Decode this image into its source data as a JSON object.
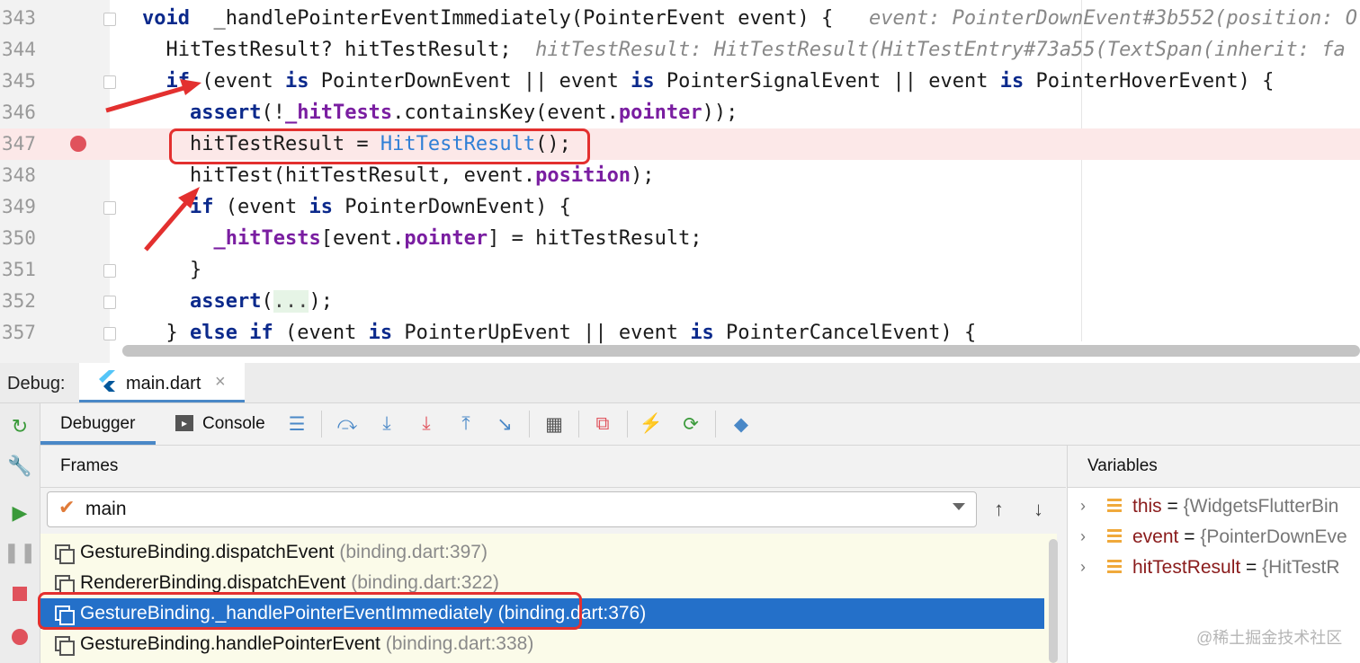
{
  "editor": {
    "lines": [
      {
        "num": "343",
        "fold": true,
        "breakpoint": false,
        "tokens": [
          [
            "kw",
            "void"
          ],
          [
            "",
            "  _handlePointerEventImmediately(PointerEvent event) {   "
          ],
          [
            "hint",
            "event: PointerDownEvent#3b552(position: Of"
          ]
        ]
      },
      {
        "num": "344",
        "fold": false,
        "breakpoint": false,
        "tokens": [
          [
            "",
            "  HitTestResult? hitTestResult;  "
          ],
          [
            "hint",
            "hitTestResult: HitTestResult(HitTestEntry#73a55(TextSpan(inherit: fa"
          ]
        ]
      },
      {
        "num": "345",
        "fold": true,
        "breakpoint": false,
        "tokens": [
          [
            "",
            "  "
          ],
          [
            "kw",
            "if"
          ],
          [
            "",
            " (event "
          ],
          [
            "kw",
            "is"
          ],
          [
            "",
            " PointerDownEvent || event "
          ],
          [
            "kw",
            "is"
          ],
          [
            "",
            " PointerSignalEvent || event "
          ],
          [
            "kw",
            "is"
          ],
          [
            "",
            " PointerHoverEvent) {"
          ]
        ]
      },
      {
        "num": "346",
        "fold": false,
        "breakpoint": false,
        "tokens": [
          [
            "",
            "    "
          ],
          [
            "kw",
            "assert"
          ],
          [
            "",
            "(!"
          ],
          [
            "fld",
            "_hitTests"
          ],
          [
            "",
            ".containsKey(event."
          ],
          [
            "fld",
            "pointer"
          ],
          [
            "",
            "));"
          ]
        ]
      },
      {
        "num": "347",
        "fold": false,
        "breakpoint": true,
        "tokens": [
          [
            "",
            "    hitTestResult = "
          ],
          [
            "typ",
            "HitTestResult"
          ],
          [
            "",
            "();"
          ]
        ]
      },
      {
        "num": "348",
        "fold": false,
        "breakpoint": false,
        "tokens": [
          [
            "",
            "    hitTest(hitTestResult, event."
          ],
          [
            "fld",
            "position"
          ],
          [
            "",
            ");"
          ]
        ]
      },
      {
        "num": "349",
        "fold": true,
        "breakpoint": false,
        "tokens": [
          [
            "",
            "    "
          ],
          [
            "kw",
            "if"
          ],
          [
            "",
            " (event "
          ],
          [
            "kw",
            "is"
          ],
          [
            "",
            " PointerDownEvent) {"
          ]
        ]
      },
      {
        "num": "350",
        "fold": false,
        "breakpoint": false,
        "tokens": [
          [
            "",
            "      "
          ],
          [
            "fld",
            "_hitTests"
          ],
          [
            "",
            "[event."
          ],
          [
            "fld",
            "pointer"
          ],
          [
            "",
            "] = hitTestResult;"
          ]
        ]
      },
      {
        "num": "351",
        "fold": true,
        "breakpoint": false,
        "tokens": [
          [
            "",
            "    }"
          ]
        ]
      },
      {
        "num": "352",
        "fold": true,
        "breakpoint": false,
        "tokens": [
          [
            "",
            "    "
          ],
          [
            "kw",
            "assert"
          ],
          [
            "",
            "("
          ],
          [
            "fold-box",
            "..."
          ],
          [
            "",
            ");"
          ]
        ]
      },
      {
        "num": "357",
        "fold": true,
        "breakpoint": false,
        "tokens": [
          [
            "",
            "  } "
          ],
          [
            "kw",
            "else if"
          ],
          [
            "",
            " (event "
          ],
          [
            "kw",
            "is"
          ],
          [
            "",
            " PointerUpEvent || event "
          ],
          [
            "kw",
            "is"
          ],
          [
            "",
            " PointerCancelEvent) {"
          ]
        ]
      }
    ]
  },
  "debug": {
    "label": "Debug:",
    "tab": "main.dart",
    "tab_close": "×",
    "tabs": [
      "Debugger",
      "Console"
    ],
    "frames_title": "Frames",
    "variables_title": "Variables",
    "thread": "main",
    "frames": [
      {
        "name": "GestureBinding.dispatchEvent",
        "loc": "(binding.dart:397)",
        "selected": false
      },
      {
        "name": "RendererBinding.dispatchEvent",
        "loc": "(binding.dart:322)",
        "selected": false
      },
      {
        "name": "GestureBinding._handlePointerEventImmediately",
        "loc": "(binding.dart:376)",
        "selected": true
      },
      {
        "name": "GestureBinding.handlePointerEvent",
        "loc": "(binding.dart:338)",
        "selected": false
      }
    ],
    "variables": [
      {
        "name": "this",
        "value": "{WidgetsFlutterBin"
      },
      {
        "name": "event",
        "value": "{PointerDownEve"
      },
      {
        "name": "hitTestResult",
        "value": "{HitTestR"
      }
    ],
    "watermark": "@稀土掘金技术社区"
  },
  "icons": {
    "rail": [
      "rerun-icon",
      "settings-wrench-icon",
      "resume-icon",
      "pause-icon",
      "stop-icon",
      "view-breakpoints-icon"
    ],
    "toolbar": [
      "list-icon",
      "step-over-icon",
      "step-into-icon",
      "force-step-into-icon",
      "step-out-icon",
      "run-to-cursor-icon",
      "evaluate-icon",
      "drop-frame-icon",
      "hot-reload-icon",
      "hot-restart-icon",
      "devtools-icon"
    ]
  },
  "colors": {
    "accent": "#2470c9",
    "breakpoint": "#e0525c",
    "annotation": "#e3302f"
  }
}
